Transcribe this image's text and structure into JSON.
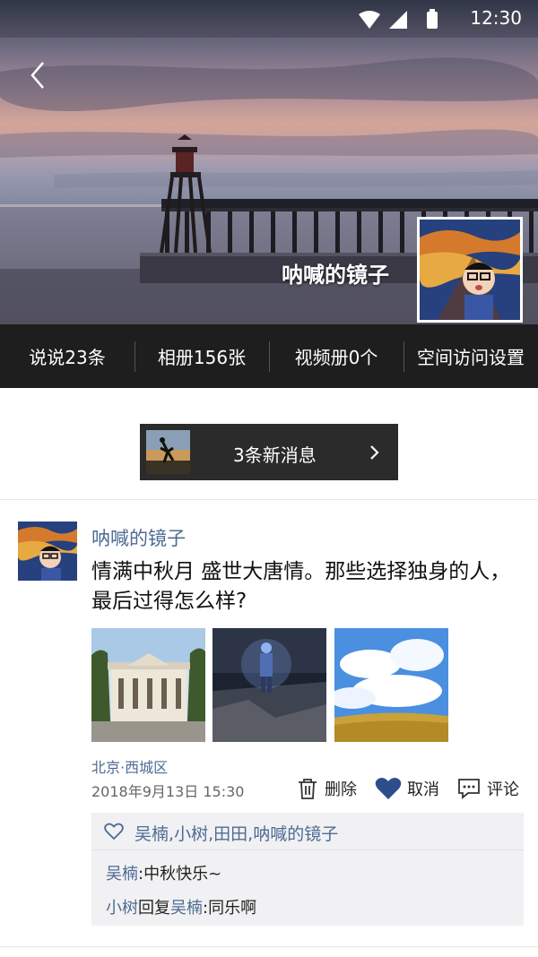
{
  "status_bar": {
    "time": "12:30",
    "icons": [
      "wifi-icon",
      "signal-icon",
      "battery-icon"
    ]
  },
  "header": {
    "back_icon": "chevron-left-icon",
    "profile_name": "呐喊的镜子"
  },
  "stats": [
    {
      "label": "说说23条"
    },
    {
      "label": "相册156张"
    },
    {
      "label": "视频册0个"
    },
    {
      "label": "空间访问设置"
    }
  ],
  "new_messages": {
    "label": "3条新消息",
    "icon": "chevron-right-icon"
  },
  "post": {
    "author": "呐喊的镜子",
    "text": "情满中秋月 盛世大唐情。那些选择独身的人，最后过得怎么样?",
    "photos": [
      "building-photo",
      "night-figure-photo",
      "sky-field-photo"
    ],
    "location": "北京·西城区",
    "timestamp": "2018年9月13日 15:30",
    "actions": {
      "delete": "删除",
      "cancel": "取消",
      "comment": "评论"
    },
    "likes": {
      "names": [
        "吴楠",
        "小树",
        "田田",
        "呐喊的镜子"
      ],
      "separator": ","
    },
    "comments": [
      {
        "user": "吴楠",
        "colon": ":",
        "text": "中秋快乐~"
      },
      {
        "user": "小树",
        "reply_word": "回复",
        "reply_to": "吴楠",
        "colon": ":",
        "text": "同乐啊"
      }
    ]
  },
  "colors": {
    "link": "#4e6b93",
    "dark_bar": "#1e1e1e",
    "pill": "#2b2b2b",
    "heart": "#2d4e8a"
  }
}
